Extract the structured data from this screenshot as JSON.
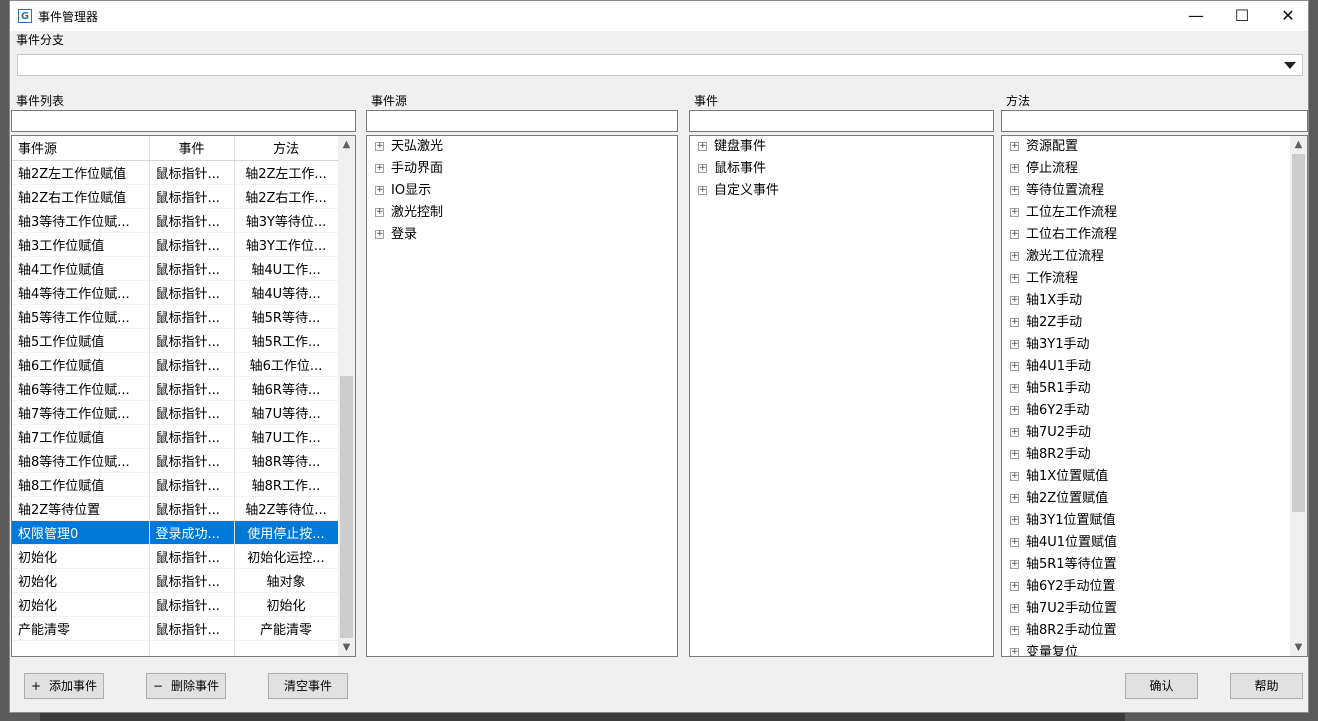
{
  "window": {
    "title": "事件管理器",
    "app_icon_glyph": "G",
    "minimize_glyph": "—",
    "maximize_glyph": "☐",
    "close_glyph": "✕"
  },
  "branch": {
    "label": "事件分支",
    "value": ""
  },
  "event_list": {
    "label": "事件列表",
    "filter_value": "",
    "columns": [
      "事件源",
      "事件",
      "方法"
    ],
    "rows": [
      [
        "轴2Z左工作位赋值",
        "鼠标指针...",
        "轴2Z左工作..."
      ],
      [
        "轴2Z右工作位赋值",
        "鼠标指针...",
        "轴2Z右工作..."
      ],
      [
        "轴3等待工作位赋...",
        "鼠标指针...",
        "轴3Y等待位..."
      ],
      [
        "轴3工作位赋值",
        "鼠标指针...",
        "轴3Y工作位..."
      ],
      [
        "轴4工作位赋值",
        "鼠标指针...",
        "轴4U工作..."
      ],
      [
        "轴4等待工作位赋...",
        "鼠标指针...",
        "轴4U等待..."
      ],
      [
        "轴5等待工作位赋...",
        "鼠标指针...",
        "轴5R等待..."
      ],
      [
        "轴5工作位赋值",
        "鼠标指针...",
        "轴5R工作..."
      ],
      [
        "轴6工作位赋值",
        "鼠标指针...",
        "轴6工作位..."
      ],
      [
        "轴6等待工作位赋...",
        "鼠标指针...",
        "轴6R等待..."
      ],
      [
        "轴7等待工作位赋...",
        "鼠标指针...",
        "轴7U等待..."
      ],
      [
        "轴7工作位赋值",
        "鼠标指针...",
        "轴7U工作..."
      ],
      [
        "轴8等待工作位赋...",
        "鼠标指针...",
        "轴8R等待..."
      ],
      [
        "轴8工作位赋值",
        "鼠标指针...",
        "轴8R工作..."
      ],
      [
        "轴2Z等待位置",
        "鼠标指针...",
        "轴2Z等待位..."
      ],
      [
        "权限管理0",
        "登录成功...",
        "使用停止按..."
      ],
      [
        "初始化",
        "鼠标指针...",
        "初始化运控..."
      ],
      [
        "初始化",
        "鼠标指针...",
        "轴对象"
      ],
      [
        "初始化",
        "鼠标指针...",
        "初始化"
      ],
      [
        "产能清零",
        "鼠标指针...",
        "产能清零"
      ],
      [
        "",
        "",
        ""
      ]
    ],
    "selected_row": 15
  },
  "event_source": {
    "label": "事件源",
    "filter_value": "",
    "items": [
      "天弘激光",
      "手动界面",
      "IO显示",
      "激光控制",
      "登录"
    ]
  },
  "events": {
    "label": "事件",
    "filter_value": "",
    "items": [
      "键盘事件",
      "鼠标事件",
      "自定义事件"
    ]
  },
  "methods": {
    "label": "方法",
    "filter_value": "",
    "items": [
      "资源配置",
      "停止流程",
      "等待位置流程",
      "工位左工作流程",
      "工位右工作流程",
      "激光工位流程",
      "工作流程",
      "轴1X手动",
      "轴2Z手动",
      "轴3Y1手动",
      "轴4U1手动",
      "轴5R1手动",
      "轴6Y2手动",
      "轴7U2手动",
      "轴8R2手动",
      "轴1X位置赋值",
      "轴2Z位置赋值",
      "轴3Y1位置赋值",
      "轴4U1位置赋值",
      "轴5R1等待位置",
      "轴6Y2手动位置",
      "轴7U2手动位置",
      "轴8R2手动位置",
      "变量复位"
    ]
  },
  "tree_expander_glyph": "+",
  "scroll_glyphs": {
    "up": "▲",
    "down": "▼"
  },
  "buttons": {
    "add": {
      "glyph": "+",
      "label": "添加事件"
    },
    "delete": {
      "glyph": "−",
      "label": "删除事件"
    },
    "clear": {
      "label": "清空事件"
    },
    "confirm": {
      "label": "确认"
    },
    "help": {
      "label": "帮助"
    }
  },
  "colors": {
    "selection": "#0078d7",
    "window_bg": "#f0f0f0"
  }
}
